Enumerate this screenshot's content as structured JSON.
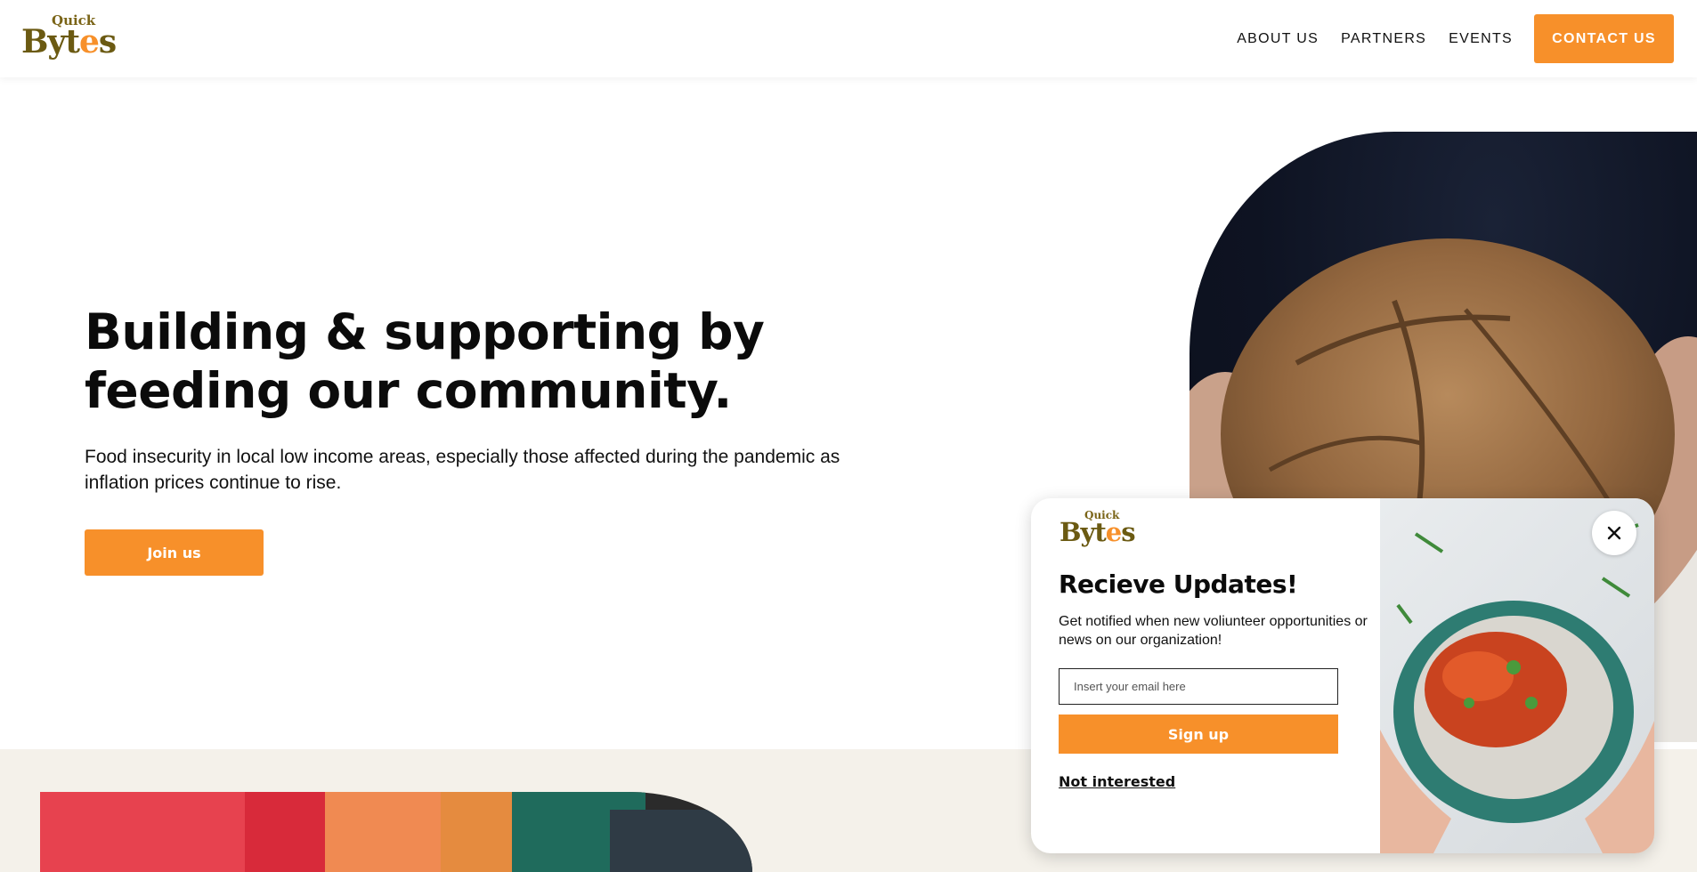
{
  "brand": {
    "logo_top": "Quick",
    "logo_main_start": "Byt",
    "logo_main_accent": "e",
    "logo_main_end": "s"
  },
  "nav": {
    "items": [
      {
        "label": "ABOUT US"
      },
      {
        "label": "PARTNERS"
      },
      {
        "label": "EVENTS"
      }
    ],
    "cta_label": "CONTACT US"
  },
  "hero": {
    "title_line1": "Building & supporting by",
    "title_line2": "feeding our community.",
    "subtitle": "Food insecurity in local low income areas, especially those affected during the pandemic as inflation prices continue to rise.",
    "join_label": "Join us"
  },
  "popup": {
    "title": "Recieve Updates!",
    "description": "Get notified when new voliunteer opportunities or news on our organization!",
    "email_placeholder": "Insert your email here",
    "signup_label": "Sign up",
    "decline_label": "Not interested",
    "close_icon": "close-icon"
  },
  "colors": {
    "accent": "#f7902a",
    "logo_brown": "#6b5a12",
    "band_bg": "#f4f1ea"
  }
}
